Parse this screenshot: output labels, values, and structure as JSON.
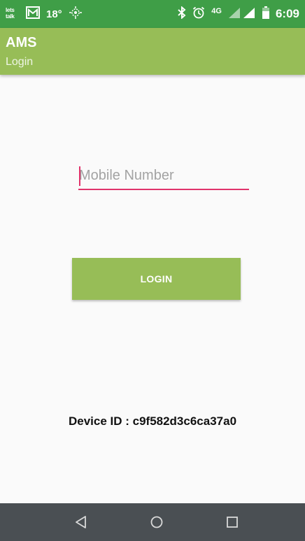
{
  "status_bar": {
    "letstalk_icon": "lets talk",
    "temperature": "18°",
    "network": "4G",
    "time": "6:09",
    "icons": [
      "letstalk-icon",
      "gmail-icon",
      "location-icon",
      "bluetooth-icon",
      "alarm-icon",
      "signal-icon",
      "battery-icon"
    ]
  },
  "app_bar": {
    "title": "AMS",
    "subtitle": "Login",
    "color": "#97bd57"
  },
  "login_form": {
    "mobile_placeholder": "Mobile Number",
    "mobile_value": "",
    "login_label": "LOGIN"
  },
  "device_id_text": "Device ID : c9f582d3c6ca37a0",
  "nav_bar": {
    "icons": [
      "back-icon",
      "home-icon",
      "recents-icon"
    ]
  },
  "colors": {
    "status_bar": "#3f9e47",
    "accent": "#e0336b",
    "primary": "#97bd57",
    "nav_bar": "#4a4f53"
  }
}
